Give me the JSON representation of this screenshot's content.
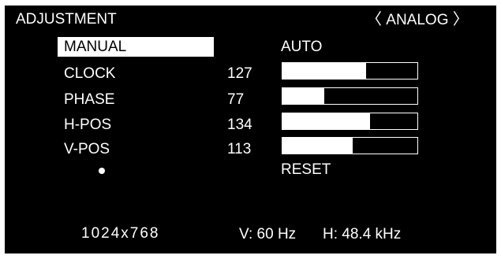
{
  "header": {
    "title": "ADJUSTMENT",
    "mode_left_bracket": "〈",
    "mode": "ANALOG",
    "mode_right_bracket": "〉"
  },
  "tabs": {
    "manual_label": "MANUAL",
    "auto_label": "AUTO"
  },
  "adjustments": [
    {
      "label": "CLOCK",
      "value": "127",
      "level": 0.62
    },
    {
      "label": "PHASE",
      "value": "77",
      "level": 0.31
    },
    {
      "label": "H-POS",
      "value": "134",
      "level": 0.65
    },
    {
      "label": "V-POS",
      "value": "113",
      "level": 0.52
    }
  ],
  "reset_label": "RESET",
  "status": {
    "resolution": "1024x768",
    "v_freq": "V: 60 Hz",
    "h_freq": "H: 48.4 kHz"
  },
  "colors": {
    "background": "#000000",
    "foreground": "#ffffff"
  }
}
